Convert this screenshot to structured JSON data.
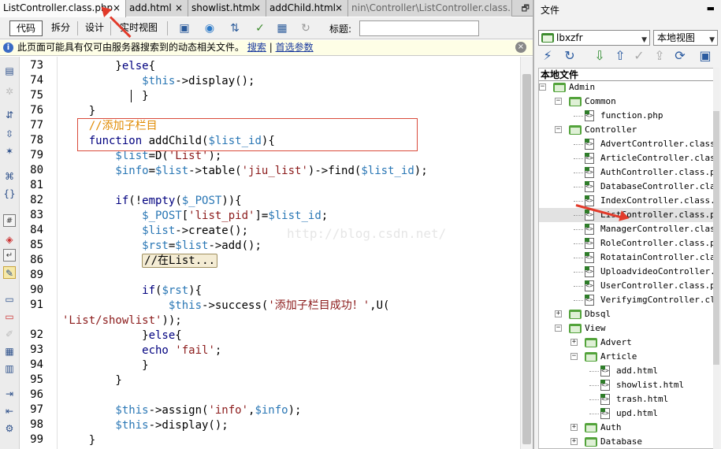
{
  "tabs": [
    {
      "label": "ListController.class.php",
      "close": "×",
      "active": true
    },
    {
      "label": "add.html",
      "close": "×"
    },
    {
      "label": "showlist.html",
      "close": "×"
    },
    {
      "label": "addChild.html",
      "close": "×"
    },
    {
      "label": "nin\\Controller\\ListController.class.php",
      "close": ""
    }
  ],
  "tab_restore": "🗗",
  "toolbar": {
    "code": "代码",
    "split": "拆分",
    "design": "设计",
    "live": "实时视图",
    "title_label": "标题:",
    "title_value": ""
  },
  "infobar": {
    "icon": "i",
    "text": "此页面可能具有仅可由服务器搜索到的动态相关文件。",
    "search": "搜索",
    "divider": "|",
    "prefs": "首选参数",
    "close": "×"
  },
  "code": {
    "lines": [
      {
        "n": "73",
        "parts": [
          [
            "p",
            "        }"
          ],
          [
            "k",
            "else"
          ],
          [
            "p",
            "{"
          ]
        ]
      },
      {
        "n": "74",
        "parts": [
          [
            "v",
            "            $this"
          ],
          [
            "p",
            "->display();"
          ]
        ]
      },
      {
        "n": "75",
        "parts": [
          [
            "p",
            "            }"
          ]
        ]
      },
      {
        "n": "76",
        "parts": [
          [
            "p",
            "    }"
          ]
        ]
      },
      {
        "n": "77",
        "parts": [
          [
            "c",
            "    //添加子栏目"
          ]
        ]
      },
      {
        "n": "78",
        "parts": [
          [
            "k",
            "    function"
          ],
          [
            "p",
            " addChild("
          ],
          [
            "v",
            "$list_id"
          ],
          [
            "p",
            "){"
          ]
        ]
      },
      {
        "n": "79",
        "parts": [
          [
            "v",
            "        $list"
          ],
          [
            "p",
            "=D("
          ],
          [
            "s",
            "'List'"
          ],
          [
            "p",
            ");"
          ]
        ]
      },
      {
        "n": "80",
        "parts": [
          [
            "v",
            "        $info"
          ],
          [
            "p",
            "="
          ],
          [
            "v",
            "$list"
          ],
          [
            "p",
            "->table("
          ],
          [
            "s",
            "'jiu_list'"
          ],
          [
            "p",
            ")->find("
          ],
          [
            "v",
            "$list_id"
          ],
          [
            "p",
            ");"
          ]
        ]
      },
      {
        "n": "81",
        "parts": []
      },
      {
        "n": "82",
        "parts": [
          [
            "k",
            "        if"
          ],
          [
            "p",
            "(!"
          ],
          [
            "k",
            "empty"
          ],
          [
            "p",
            "("
          ],
          [
            "v",
            "$_POST"
          ],
          [
            "p",
            ")){"
          ]
        ]
      },
      {
        "n": "83",
        "parts": [
          [
            "v",
            "            $_POST"
          ],
          [
            "p",
            "["
          ],
          [
            "s",
            "'list_pid'"
          ],
          [
            "p",
            "]="
          ],
          [
            "v",
            "$list_id"
          ],
          [
            "p",
            ";"
          ]
        ]
      },
      {
        "n": "84",
        "parts": [
          [
            "v",
            "            $list"
          ],
          [
            "p",
            "->create();"
          ]
        ]
      },
      {
        "n": "85",
        "parts": [
          [
            "v",
            "            $rst"
          ],
          [
            "p",
            "="
          ],
          [
            "v",
            "$list"
          ],
          [
            "p",
            "->add();"
          ]
        ]
      },
      {
        "n": "86",
        "parts": [
          [
            "p",
            "            "
          ]
        ],
        "collapsed": "//在List..."
      },
      {
        "n": "89",
        "parts": []
      },
      {
        "n": "90",
        "parts": [
          [
            "k",
            "            if"
          ],
          [
            "p",
            "("
          ],
          [
            "v",
            "$rst"
          ],
          [
            "p",
            "){"
          ]
        ]
      },
      {
        "n": "91",
        "parts": [
          [
            "v",
            "                $this"
          ],
          [
            "p",
            "->success("
          ],
          [
            "s",
            "'添加子栏目成功！'"
          ],
          [
            "p",
            ",U("
          ]
        ]
      },
      {
        "n": "",
        "parts": [
          [
            "s",
            "'List/showlist'"
          ],
          [
            "p",
            "));"
          ]
        ]
      },
      {
        "n": "92",
        "parts": [
          [
            "p",
            "            }"
          ],
          [
            "k",
            "else"
          ],
          [
            "p",
            "{"
          ]
        ]
      },
      {
        "n": "93",
        "parts": [
          [
            "k",
            "            echo"
          ],
          [
            "p",
            " "
          ],
          [
            "s",
            "'fail'"
          ],
          [
            "p",
            ";"
          ]
        ]
      },
      {
        "n": "94",
        "parts": [
          [
            "p",
            "            }"
          ]
        ]
      },
      {
        "n": "95",
        "parts": [
          [
            "p",
            "        }"
          ]
        ]
      },
      {
        "n": "96",
        "parts": []
      },
      {
        "n": "97",
        "parts": [
          [
            "v",
            "        $this"
          ],
          [
            "p",
            "->assign("
          ],
          [
            "s",
            "'info'"
          ],
          [
            "p",
            ","
          ],
          [
            "v",
            "$info"
          ],
          [
            "p",
            ");"
          ]
        ]
      },
      {
        "n": "98",
        "parts": [
          [
            "v",
            "        $this"
          ],
          [
            "p",
            "->display();"
          ]
        ]
      },
      {
        "n": "99",
        "parts": [
          [
            "p",
            "    }"
          ]
        ]
      }
    ],
    "watermark": "http://blog.csdn.net/"
  },
  "files_panel": {
    "title": "文件",
    "minimize": "▬",
    "site": "lbxzfr",
    "view": "本地视图",
    "header": "本地文件",
    "tree": [
      {
        "label": "Admin",
        "type": "folder",
        "toggle": "−",
        "depth": 3
      },
      {
        "label": "Common",
        "type": "folder",
        "toggle": "−",
        "depth": 4
      },
      {
        "label": "function.php",
        "type": "file",
        "depth": 5
      },
      {
        "label": "Controller",
        "type": "folder",
        "toggle": "−",
        "depth": 4
      },
      {
        "label": "AdvertController.class.php",
        "type": "file",
        "depth": 5
      },
      {
        "label": "ArticleController.class.php",
        "type": "file",
        "depth": 5
      },
      {
        "label": "AuthController.class.php",
        "type": "file",
        "depth": 5
      },
      {
        "label": "DatabaseController.class.php",
        "type": "file",
        "depth": 5
      },
      {
        "label": "IndexController.class.php",
        "type": "file",
        "depth": 5
      },
      {
        "label": "ListController.class.php",
        "type": "file",
        "depth": 5,
        "selected": true
      },
      {
        "label": "ManagerController.class.php",
        "type": "file",
        "depth": 5
      },
      {
        "label": "RoleController.class.php",
        "type": "file",
        "depth": 5
      },
      {
        "label": "RotatainController.class.php",
        "type": "file",
        "depth": 5
      },
      {
        "label": "UploadvideoController.class.php",
        "type": "file",
        "depth": 5
      },
      {
        "label": "UserController.class.php",
        "type": "file",
        "depth": 5
      },
      {
        "label": "VerifyimgController.class.php",
        "type": "file",
        "depth": 5
      },
      {
        "label": "Dbsql",
        "type": "folder",
        "toggle": "+",
        "depth": 4
      },
      {
        "label": "View",
        "type": "folder",
        "toggle": "−",
        "depth": 4
      },
      {
        "label": "Advert",
        "type": "folder",
        "toggle": "+",
        "depth": 5
      },
      {
        "label": "Article",
        "type": "folder",
        "toggle": "−",
        "depth": 5
      },
      {
        "label": "add.html",
        "type": "file",
        "depth": 6
      },
      {
        "label": "showlist.html",
        "type": "file",
        "depth": 6
      },
      {
        "label": "trash.html",
        "type": "file",
        "depth": 6
      },
      {
        "label": "upd.html",
        "type": "file",
        "depth": 6
      },
      {
        "label": "Auth",
        "type": "folder",
        "toggle": "+",
        "depth": 5
      },
      {
        "label": "Database",
        "type": "folder",
        "toggle": "+",
        "depth": 5
      }
    ]
  },
  "colors": {
    "annotation": "#e23a2a",
    "keyword": "#00007f",
    "variable": "#2a77b5",
    "string": "#8b1a1a",
    "comment": "#e08a00"
  }
}
